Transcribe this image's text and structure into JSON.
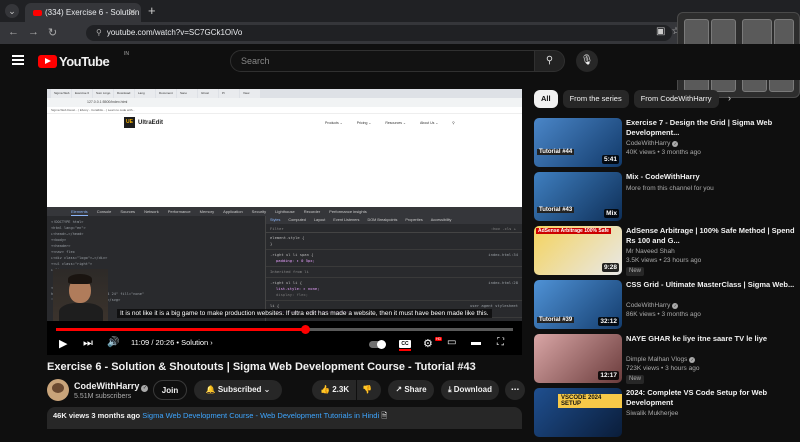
{
  "browser": {
    "tab_title": "(334) Exercise 6 - Solution & Sh",
    "url": "youtube.com/watch?v=SC7GCk1OiVo"
  },
  "youtube": {
    "logo_text": "YouTube",
    "logo_region": "IN",
    "search_placeholder": "Search"
  },
  "player": {
    "current_time": "11:09",
    "duration": "20:26",
    "chapter": "Solution",
    "chapter_sep": "•",
    "time_sep": "/",
    "progress": 0.545,
    "captions": "It is not like it is a big game to make production websites. If ultra edit has made a website, then it must have been made like this.",
    "cc_label": "CC",
    "hd_label": "HD",
    "inner_site": {
      "logo_short": "UE",
      "logo_name": "UltraEdit",
      "nav": [
        "Products ⌄",
        "Pricing ⌄",
        "Resources ⌄",
        "About Us ⌄"
      ],
      "devtools_tabs": [
        "Elements",
        "Console",
        "Sources",
        "Network",
        "Performance",
        "Memory",
        "Application",
        "Security",
        "Lighthouse",
        "Recorder",
        "Performance insights"
      ],
      "styles_tabs": [
        "Styles",
        "Computed",
        "Layout",
        "Event Listeners",
        "DOM Breakpoints",
        "Properties",
        "Accessibility"
      ],
      "filter_placeholder": "Filter",
      "filter_tools": ":hov .cls + ",
      "elements_lines": [
        "<!DOCTYPE html>",
        "<html lang=\"en\">",
        "  ▸<head>…</head>",
        "  ▾<body>",
        "    ▾<header>",
        "      ▾<nav> flex",
        "        ▸<div class=\"logo\">…</div>",
        "        ▾<ul class=\"right\">",
        "          ▸<li>",
        "",
        "",
        "            <span> == $0",
        "            height=\"20\" viewBox=\"0 0 24 24\" fill=\"none\"",
        "            \"../www.w3.org/2000/svg\">…</svg>"
      ],
      "style_rules": [
        {
          "sel": "element.style {",
          "body": "}",
          "src": ""
        },
        {
          "sel": ".right ul li span {",
          "body": "padding: ▸ 0 5px;",
          "src": "index.html:34"
        },
        {
          "sel": "Inherited from li",
          "body": "",
          "src": ""
        },
        {
          "sel": ".right ul li {",
          "body": "list-style: ▸ none;",
          "src": "index.html:28"
        },
        {
          "sel": "display: flex;",
          "body": "align-items: center;",
          "src": ""
        },
        {
          "sel": "li {",
          "body": "text-align: -webkit-match-parent;",
          "src": "user agent stylesheet"
        }
      ]
    }
  },
  "video": {
    "title": "Exercise 6 - Solution & Shoutouts | Sigma Web Development Course - Tutorial #43",
    "channel": "CodeWithHarry",
    "subscribers": "5.51M subscribers",
    "join_label": "Join",
    "subscribed_label": "Subscribed",
    "likes": "2.3K",
    "share_label": "Share",
    "download_label": "Download",
    "views": "46K views",
    "age": "3 months ago",
    "playlist": "Sigma Web Development Course - Web Development Tutorials in Hindi"
  },
  "sidebar": {
    "chips": [
      "All",
      "From the series",
      "From CodeWithHarry"
    ],
    "recs": [
      {
        "title": "Exercise 7 - Design the Grid | Sigma Web Development...",
        "channel": "CodeWithHarry",
        "verified": true,
        "meta": "40K views • 3 months ago",
        "duration": "5:41",
        "thumb_label": "Tutorial #44",
        "badge": ""
      },
      {
        "title": "Mix - CodeWithHarry",
        "channel": "More from this channel for you",
        "verified": false,
        "meta": "",
        "duration": "Mix",
        "thumb_label": "Tutorial #43",
        "badge": ""
      },
      {
        "title": "AdSense Arbitrage | 100% Safe Method | Spend Rs 100 and G...",
        "channel": "Mr Naveed Shah",
        "verified": false,
        "meta": "3.5K views • 23 hours ago",
        "duration": "9:28",
        "thumb_label": "AdSense Arbitrage 100% Safe",
        "badge": "New"
      },
      {
        "title": "CSS Grid - Ultimate MasterClass | Sigma Web...",
        "channel": "CodeWithHarry",
        "verified": true,
        "meta": "86K views • 3 months ago",
        "duration": "32:12",
        "thumb_label": "Tutorial #39",
        "badge": ""
      },
      {
        "title": "NAYE GHAR ke liye itne saare TV le liye",
        "channel": "Dimple Malhan Vlogs",
        "verified": true,
        "meta": "723K views • 3 hours ago",
        "duration": "12:17",
        "thumb_label": "",
        "badge": "New"
      },
      {
        "title": "2024: Complete VS Code Setup for Web Development",
        "channel": "Siwalik Mukherjee",
        "verified": false,
        "meta": "",
        "duration": "",
        "thumb_label": "VSCODE 2024 SETUP",
        "badge": ""
      }
    ]
  },
  "colors": {
    "accent": "#ff0000",
    "bg": "#0f0f0f",
    "chip": "#272727",
    "link": "#3ea6ff"
  }
}
